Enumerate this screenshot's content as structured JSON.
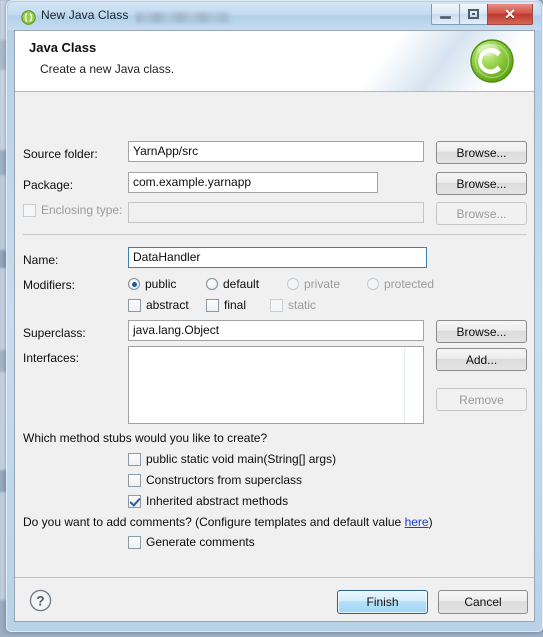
{
  "window": {
    "title": "New Java Class",
    "icon": "eclipse-icon",
    "controls": {
      "minimize": "minimize-icon",
      "maximize": "restore-icon",
      "close": "close-icon"
    }
  },
  "header": {
    "title": "Java Class",
    "subtitle": "Create a new Java class.",
    "logo": "java-class-logo"
  },
  "form": {
    "source_folder": {
      "label": "Source folder:",
      "value": "YarnApp/src",
      "browse": "Browse..."
    },
    "package": {
      "label": "Package:",
      "value": "com.example.yarnapp",
      "browse": "Browse..."
    },
    "enclosing_type": {
      "label": "Enclosing type:",
      "value": "",
      "checked": false,
      "browse": "Browse...",
      "enabled": false
    },
    "name": {
      "label": "Name:",
      "value": "DataHandler"
    },
    "modifiers": {
      "label": "Modifiers:",
      "radios": [
        {
          "label": "public",
          "checked": true,
          "enabled": true
        },
        {
          "label": "default",
          "checked": false,
          "enabled": true
        },
        {
          "label": "private",
          "checked": false,
          "enabled": false
        },
        {
          "label": "protected",
          "checked": false,
          "enabled": false
        }
      ],
      "checkboxes": [
        {
          "label": "abstract",
          "checked": false,
          "enabled": true
        },
        {
          "label": "final",
          "checked": false,
          "enabled": true
        },
        {
          "label": "static",
          "checked": false,
          "enabled": false
        }
      ]
    },
    "superclass": {
      "label": "Superclass:",
      "value": "java.lang.Object",
      "browse": "Browse..."
    },
    "interfaces": {
      "label": "Interfaces:",
      "items": [],
      "add": "Add...",
      "remove": "Remove",
      "remove_enabled": false
    }
  },
  "stubs": {
    "question": "Which method stubs would you like to create?",
    "options": [
      {
        "label": "public static void main(String[] args)",
        "checked": false
      },
      {
        "label": "Constructors from superclass",
        "checked": false
      },
      {
        "label": "Inherited abstract methods",
        "checked": true
      }
    ]
  },
  "comments": {
    "question_prefix": "Do you want to add comments? (Configure templates and default value ",
    "link": "here",
    "question_suffix": ")",
    "option": {
      "label": "Generate comments",
      "checked": false
    }
  },
  "footer": {
    "help": "help-icon",
    "finish": "Finish",
    "cancel": "Cancel"
  },
  "colors": {
    "accent": "#1e5b9e",
    "link": "#1a3fd0",
    "close_button": "#bf3a2e",
    "logo_green": "#7dc242"
  }
}
